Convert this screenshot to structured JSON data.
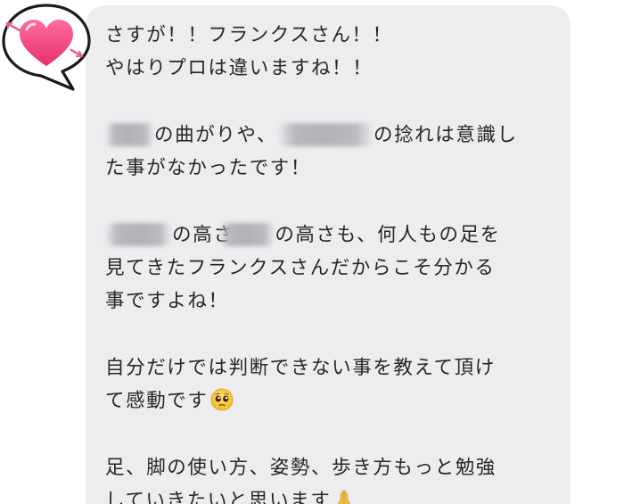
{
  "message": {
    "p1": {
      "line1": "さすが！！フランクスさん！！",
      "line2": "やはりプロは違いますね！！"
    },
    "p2": {
      "line1_a": "の曲がりや、",
      "line1_b": "の捻れは意識し",
      "line2": "た事がなかったです！"
    },
    "p3": {
      "line1_a": "の高さ",
      "line1_b": "の高さも、何人もの足を",
      "line2": "見てきたフランクスさんだからこそ分かる",
      "line3": "事ですよね！"
    },
    "p4": {
      "line1": "自分だけでは判断できない事を教えて頂け",
      "line2": "て感動です"
    },
    "p5": {
      "line1": "足、脚の使い方、姿勢、歩き方もっと勉強",
      "line2": "していきたいと思います"
    }
  },
  "icons": {
    "sticker": "heart-speech-bubble-icon",
    "emoji_1": "pleading-face-emoji-icon",
    "emoji_2": "folded-hands-emoji-icon"
  },
  "colors": {
    "bubble_background": "#ededf0",
    "text": "#262626",
    "heart": "#ee3b7a"
  }
}
